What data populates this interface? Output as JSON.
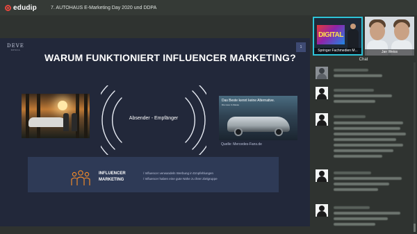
{
  "app": {
    "logo_text": "edudip",
    "event_title": "7. AUTOHAUS E-Marketing Day 2020 und DDPA"
  },
  "slide": {
    "logo": "DEVE",
    "logo_sub": "MEDIA",
    "number": "1",
    "title": "WARUM FUNKTIONIERT INFLUENCER MARKETING?",
    "center_text": "Absender - Empfänger",
    "ad_headline": "Das Beste kennt keine Alternative.",
    "ad_subline": "Die neue C-Klasse",
    "source": "Quelle: Mercedes-Fans.de",
    "influencer_label_1": "INFLUENCER",
    "influencer_label_2": "MARKETING",
    "bullets": [
      "/  Influencer verwandeln Werbung in Empfehlungen",
      "/  Influencer haben eine gute Nähe zu ihrer Zielgruppe"
    ]
  },
  "participants": [
    {
      "name": "Springer Fachmedien M...",
      "tile_text": "DIGITAL"
    },
    {
      "name": "Jan Weiss"
    }
  ],
  "chat": {
    "title": "Chat"
  },
  "colors": {
    "accent": "#e5473d",
    "active_speaker": "#2ec4d8",
    "slide_bg": "#22283a",
    "icon_orange": "#f08a2a"
  }
}
